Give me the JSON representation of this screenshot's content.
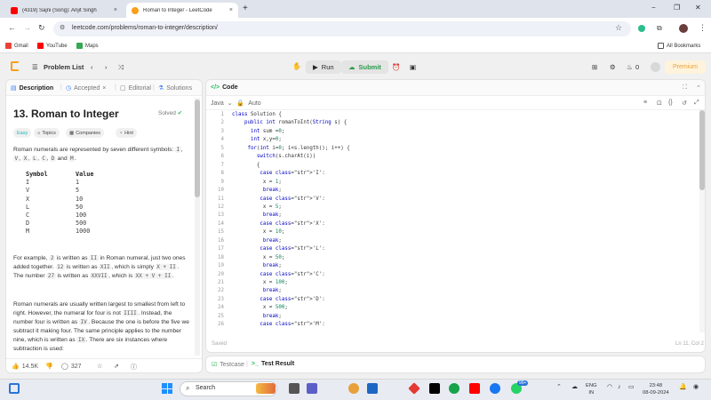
{
  "browser": {
    "tabs": [
      {
        "title": "(4319) Sajni (Song): Arijit Singh",
        "close": "×"
      },
      {
        "title": "Roman to Integer - LeetCode",
        "close": "×"
      }
    ],
    "new_tab": "+",
    "window_controls": [
      "−",
      "❐",
      "✕"
    ],
    "url": "leetcode.com/problems/roman-to-integer/description/",
    "bookmarks": [
      "Gmail",
      "YouTube",
      "Maps"
    ],
    "all_bookmarks": "All Bookmarks",
    "colors": {
      "youtube": "#ff0000",
      "leetcode": "#f89f1b",
      "gmail": "#ea4335",
      "maps": "#34a853"
    }
  },
  "header": {
    "problem_list": "Problem List",
    "run": "Run",
    "submit": "Submit",
    "streak": "0",
    "premium": "Premium"
  },
  "left": {
    "tabs": [
      "Description",
      "Accepted",
      "Editorial",
      "Solutions"
    ],
    "title": "13. Roman to Integer",
    "solved": "Solved",
    "chips": [
      "Easy",
      "Topics",
      "Companies",
      "Hint"
    ],
    "p1a": "Roman numerals are represented by seven different symbols: ",
    "p1_symbols": [
      "I",
      "V",
      "X",
      "L",
      "C",
      "D"
    ],
    "p1_and": " and ",
    "p1_last": "M",
    "p1_end": ".",
    "table_header": [
      "Symbol",
      "Value"
    ],
    "table_rows": [
      [
        "I",
        "1"
      ],
      [
        "V",
        "5"
      ],
      [
        "X",
        "10"
      ],
      [
        "L",
        "50"
      ],
      [
        "C",
        "100"
      ],
      [
        "D",
        "500"
      ],
      [
        "M",
        "1000"
      ]
    ],
    "p2": {
      "t1": "For example, ",
      "c1": "2",
      "t2": " is written as ",
      "c2": "II",
      "t3": " in Roman numeral, just two ones added together. ",
      "c3": "12",
      "t4": " is written as ",
      "c4": "XII",
      "t5": ", which is simply ",
      "c5": "X + II",
      "t6": ". The number ",
      "c6": "27",
      "t7": " is written as ",
      "c7": "XXVII",
      "t8": ", which is ",
      "c8": "XX + V + II",
      "t9": "."
    },
    "p3": {
      "t1": "Roman numerals are usually written largest to smallest from left to right. However, the numeral for four is not ",
      "c1": "IIII",
      "t2": ". Instead, the number four is written as ",
      "c2": "IV",
      "t3": ". Because the one is before the five we subtract it making four. The same principle applies to the number nine, which is written as ",
      "c3": "IX",
      "t4": ". There are six instances where subtraction is used:"
    },
    "likes": "14.5K",
    "comments": "327"
  },
  "right": {
    "tab": "Code",
    "language": "Java",
    "auto": "Auto",
    "saved": "Saved",
    "cursor": "Ln 11, Col 2",
    "lines": [
      "class Solution {",
      "    public int romanToInt(String s) {",
      "      int sum =0;",
      "      int x,y=0;",
      "     for(int i=0; i<s.length(); i++) {",
      "        switch(s.charAt(i))",
      "        {",
      "         case 'I':",
      "          x = 1;",
      "          break;",
      "         case 'V':",
      "          x = 5;",
      "          break;",
      "         case 'X':",
      "          x = 10;",
      "          break;",
      "         case 'L':",
      "          x = 50;",
      "          break;",
      "         case 'C':",
      "          x = 100;",
      "          break;",
      "         case 'D':",
      "          x = 500;",
      "          break;",
      "         case 'M':"
    ]
  },
  "bottom": {
    "testcase": "Testcase",
    "test_result": "Test Result"
  },
  "taskbar": {
    "search": "Search",
    "lang": "ENG",
    "region": "IN",
    "time": "23:48",
    "date": "08-09-2024",
    "badge": "99+"
  }
}
